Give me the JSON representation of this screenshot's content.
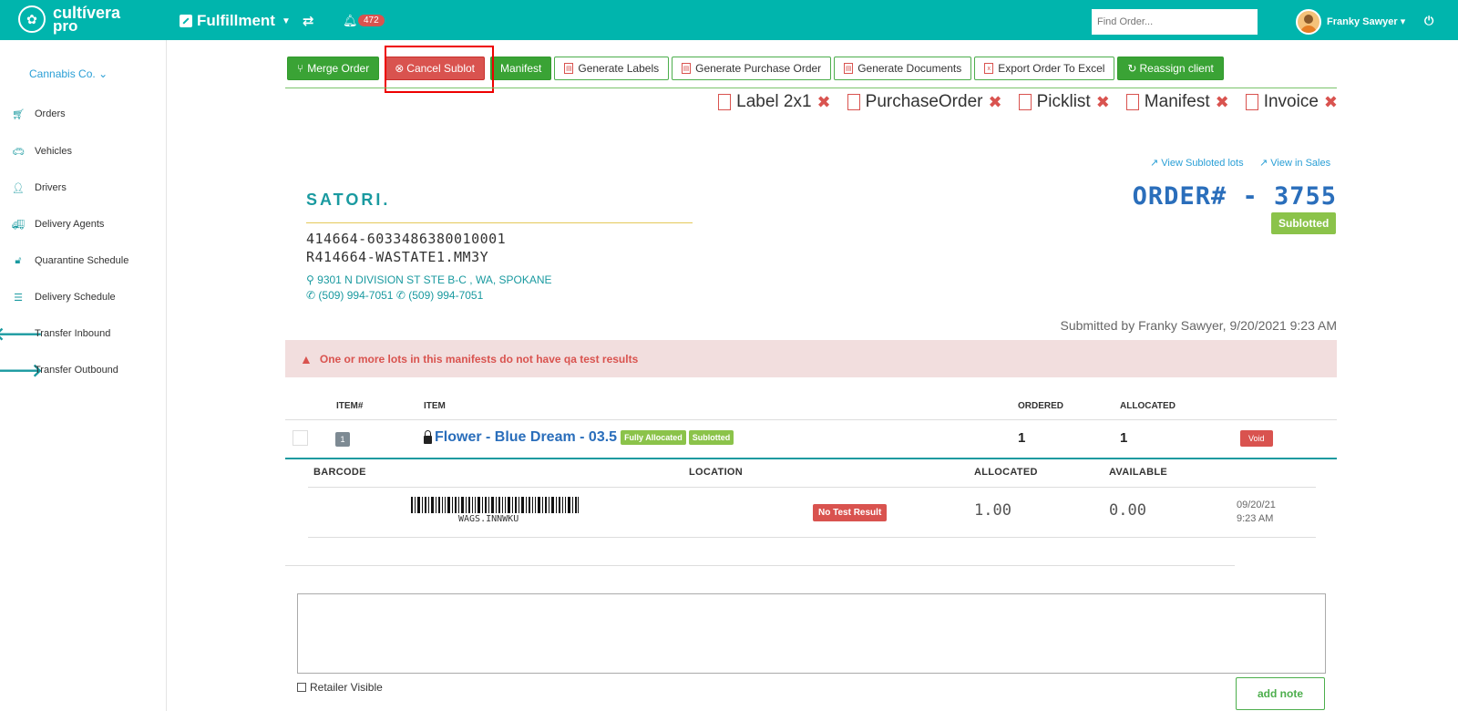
{
  "header": {
    "logo_line1": "cultívera",
    "logo_line2": "pro",
    "module": "Fulfillment",
    "notification_count": "472",
    "search_placeholder": "Find Order...",
    "user_name": "Franky Sawyer"
  },
  "sidebar": {
    "client": "Cannabis Co.",
    "items": [
      {
        "label": "Orders",
        "icon": "cart-icon"
      },
      {
        "label": "Vehicles",
        "icon": "car-icon"
      },
      {
        "label": "Drivers",
        "icon": "user-icon"
      },
      {
        "label": "Delivery Agents",
        "icon": "truck-icon"
      },
      {
        "label": "Quarantine Schedule",
        "icon": "unlock-icon"
      },
      {
        "label": "Delivery Schedule",
        "icon": "list-icon"
      },
      {
        "label": "Transfer Inbound",
        "icon": "arrow-left-icon"
      },
      {
        "label": "Transfer Outbound",
        "icon": "arrow-right-icon"
      }
    ]
  },
  "toolbar": {
    "merge": "Merge Order",
    "cancel_sublot": "Cancel Sublot",
    "manifest": "Manifest",
    "gen_labels": "Generate Labels",
    "gen_po": "Generate Purchase Order",
    "gen_docs": "Generate Documents",
    "export": "Export Order To Excel",
    "reassign": "Reassign client"
  },
  "documents": [
    "Label 2x1",
    "PurchaseOrder",
    "Picklist",
    "Manifest",
    "Invoice"
  ],
  "links": {
    "view_sublotted": "View Subloted lots",
    "view_sales": "View in Sales"
  },
  "vendor": {
    "name": "SATORI.",
    "license1": "414664-6033486380010001",
    "license2": "R414664-WASTATE1.MM3Y",
    "address": "9301 N DIVISION ST STE B-C , WA, SPOKANE",
    "phone1": "(509) 994-7051",
    "phone2": "(509) 994-7051"
  },
  "order": {
    "number": "ORDER# - 3755",
    "status": "Sublotted",
    "submitted": "Submitted by Franky Sawyer, 9/20/2021 9:23 AM"
  },
  "alert": "One or more lots in this manifests do not have qa test results",
  "items_table": {
    "headers": {
      "item_no": "ITEM#",
      "item": "ITEM",
      "ordered": "ORDERED",
      "allocated": "ALLOCATED"
    },
    "rows": [
      {
        "item_no": "1",
        "name": "Flower - Blue Dream - 03.5",
        "tags": [
          "Fully Allocated",
          "Sublotted"
        ],
        "ordered": "1",
        "allocated": "1",
        "action": "Void"
      }
    ]
  },
  "lots_table": {
    "headers": {
      "barcode": "BARCODE",
      "location": "LOCATION",
      "allocated": "ALLOCATED",
      "available": "AVAILABLE"
    },
    "rows": [
      {
        "barcode_text": "WAGS.INNWKU",
        "test_status": "No Test Result",
        "allocated": "1.00",
        "available": "0.00",
        "date": "09/20/21",
        "time": "9:23 AM"
      }
    ]
  },
  "notes": {
    "retailer_visible": "Retailer Visible",
    "add_note": "add note"
  },
  "colors": {
    "brand": "#00b5ad",
    "green": "#3aa335",
    "red": "#d9534f",
    "blue": "#2a6ebb"
  }
}
